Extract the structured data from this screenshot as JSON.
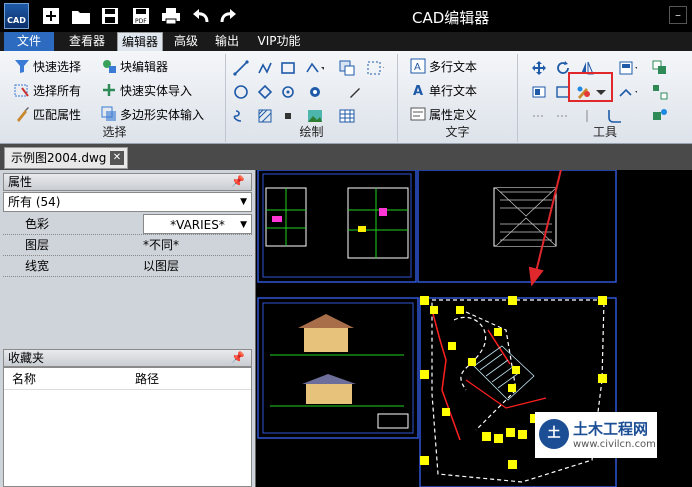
{
  "titlebar": {
    "logo_text": "CAD",
    "title": "CAD编辑器"
  },
  "menu": {
    "tabs": [
      "文件",
      "查看器",
      "编辑器",
      "高级",
      "输出",
      "VIP功能"
    ],
    "active_index": 2
  },
  "ribbon": {
    "select_group": {
      "title": "选择",
      "items": [
        "快速选择",
        "选择所有",
        "匹配属性",
        "块编辑器",
        "快速实体导入",
        "多边形实体输入"
      ]
    },
    "draw_group": {
      "title": "绘制"
    },
    "text_group": {
      "title": "文字",
      "items": [
        "多行文本",
        "单行文本",
        "属性定义"
      ]
    },
    "tools_group": {
      "title": "工具"
    }
  },
  "document": {
    "tab_label": "示例图2004.dwg",
    "close_glyph": "✕"
  },
  "properties": {
    "header": "属性",
    "pin": "ᴘ",
    "selection": "所有 (54)",
    "rows": [
      {
        "key": "色彩",
        "value": "*VARIES*"
      },
      {
        "key": "图层",
        "value": "*不同*"
      },
      {
        "key": "线宽",
        "value": "以图层"
      }
    ]
  },
  "favorites": {
    "header": "收藏夹",
    "columns": [
      "名称",
      "路径"
    ]
  },
  "watermark": {
    "badge": "土",
    "name": "土木工程网",
    "url": "www.civilcn.com"
  },
  "colors": {
    "file_tab": "#2d6bc0",
    "highlight": "#e0272b",
    "grip": "#ffff00",
    "canvas": "#000000"
  }
}
